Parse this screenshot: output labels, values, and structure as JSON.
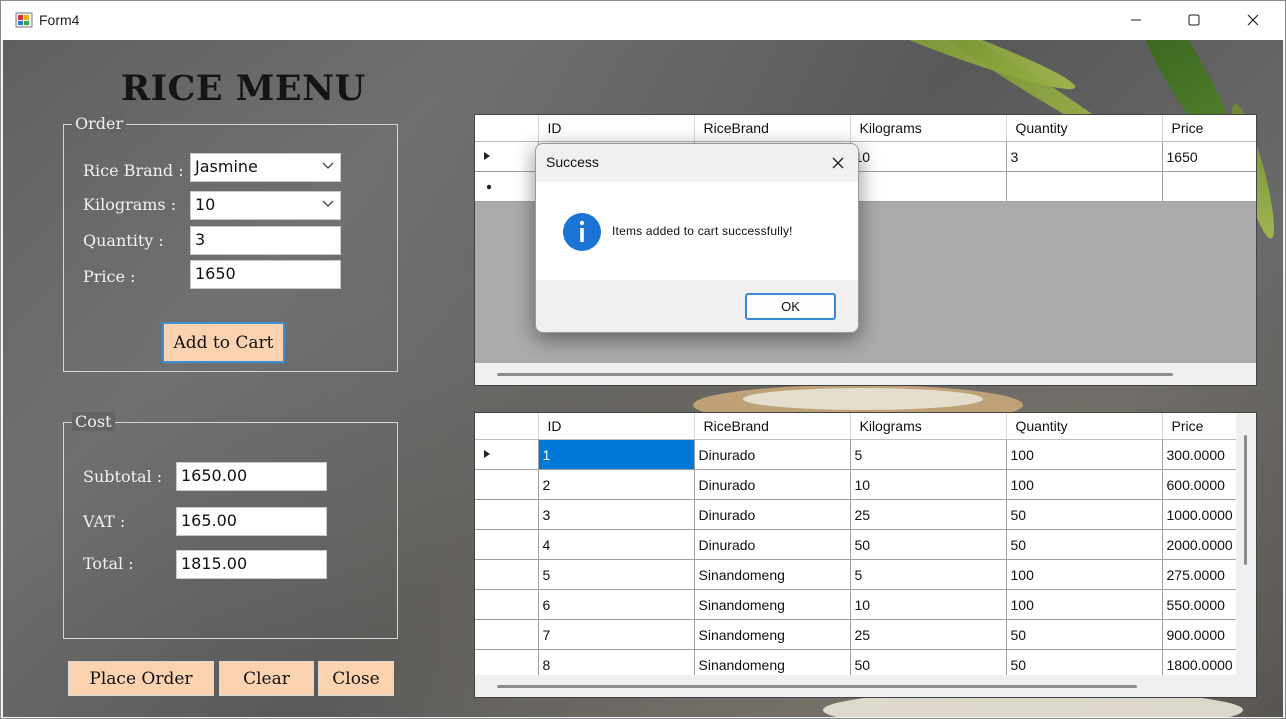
{
  "window": {
    "title": "Form4"
  },
  "heading": "RICE MENU",
  "order": {
    "group_title": "Order",
    "rice_brand_label": "Rice Brand :",
    "rice_brand_value": "Jasmine",
    "kilograms_label": "Kilograms :",
    "kilograms_value": "10",
    "quantity_label": "Quantity :",
    "quantity_value": "3",
    "price_label": "Price :",
    "price_value": "1650",
    "add_button": "Add to Cart"
  },
  "cost": {
    "group_title": "Cost",
    "subtotal_label": "Subtotal :",
    "subtotal_value": "1650.00",
    "vat_label": "VAT :",
    "vat_value": "165.00",
    "total_label": "Total :",
    "total_value": "1815.00"
  },
  "buttons": {
    "place_order": "Place Order",
    "clear": "Clear",
    "close": "Close"
  },
  "cart_grid": {
    "columns": [
      "ID",
      "RiceBrand",
      "Kilograms",
      "Quantity",
      "Price"
    ],
    "rows": [
      {
        "id": "",
        "brand": "",
        "kg": "10",
        "qty": "3",
        "price": "1650"
      }
    ]
  },
  "menu_grid": {
    "columns": [
      "ID",
      "RiceBrand",
      "Kilograms",
      "Quantity",
      "Price"
    ],
    "rows": [
      {
        "id": "1",
        "brand": "Dinurado",
        "kg": "5",
        "qty": "100",
        "price": "300.0000"
      },
      {
        "id": "2",
        "brand": "Dinurado",
        "kg": "10",
        "qty": "100",
        "price": "600.0000"
      },
      {
        "id": "3",
        "brand": "Dinurado",
        "kg": "25",
        "qty": "50",
        "price": "1000.0000"
      },
      {
        "id": "4",
        "brand": "Dinurado",
        "kg": "50",
        "qty": "50",
        "price": "2000.0000"
      },
      {
        "id": "5",
        "brand": "Sinandomeng",
        "kg": "5",
        "qty": "100",
        "price": "275.0000"
      },
      {
        "id": "6",
        "brand": "Sinandomeng",
        "kg": "10",
        "qty": "100",
        "price": "550.0000"
      },
      {
        "id": "7",
        "brand": "Sinandomeng",
        "kg": "25",
        "qty": "50",
        "price": "900.0000"
      },
      {
        "id": "8",
        "brand": "Sinandomeng",
        "kg": "50",
        "qty": "50",
        "price": "1800.0000"
      }
    ]
  },
  "dialog": {
    "title": "Success",
    "message": "Items added to cart successfully!",
    "ok": "OK"
  },
  "colors": {
    "button_bg": "#fbd3b0",
    "selection": "#0078d7",
    "info_icon": "#1a74d4",
    "focus_border": "#3c8ad6"
  }
}
